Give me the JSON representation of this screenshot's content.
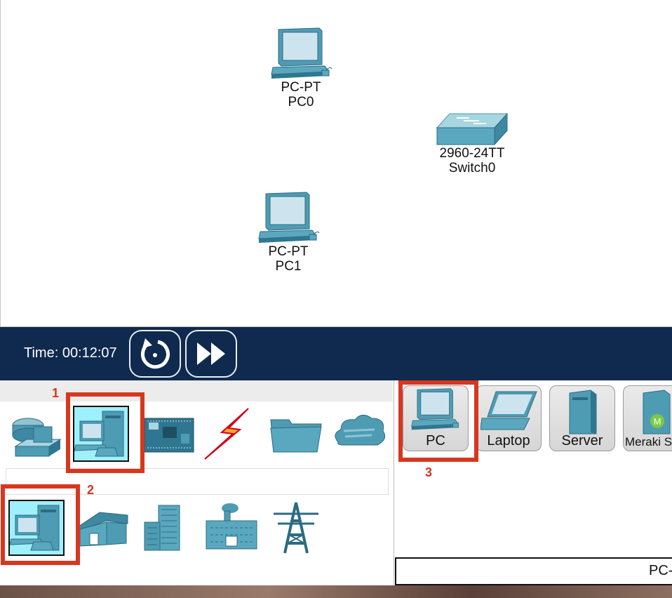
{
  "workspace": {
    "devices": [
      {
        "model": "PC-PT",
        "name": "PC0",
        "icon": "pc-icon"
      },
      {
        "model": "2960-24TT",
        "name": "Switch0",
        "icon": "switch-icon"
      },
      {
        "model": "PC-PT",
        "name": "PC1",
        "icon": "pc-icon"
      }
    ]
  },
  "timebar": {
    "time_label": "Time: 00:12:07",
    "reset_icon": "reset-time-icon",
    "fast_forward_icon": "fast-forward-icon"
  },
  "device_categories": {
    "top_row": [
      "network-devices-icon",
      "end-devices-icon",
      "components-icon",
      "connections-icon",
      "misc-icon",
      "multiuser-icon"
    ],
    "bottom_row": [
      "end-devices-icon",
      "home-icon",
      "smart-city-icon",
      "industrial-icon",
      "power-grid-icon"
    ]
  },
  "device_list": {
    "items": [
      {
        "label": "PC",
        "icon": "pc-icon"
      },
      {
        "label": "Laptop",
        "icon": "laptop-icon"
      },
      {
        "label": "Server",
        "icon": "server-icon"
      },
      {
        "label": "Meraki Ser",
        "icon": "meraki-server-icon"
      }
    ]
  },
  "annotations": [
    "1",
    "2",
    "3"
  ],
  "status": {
    "text": "PC-"
  },
  "colors": {
    "timebar": "#0f2a4e",
    "highlight": "#d7371f",
    "selected": "#9ef0fb",
    "device_blue": "#3d8fa8"
  }
}
